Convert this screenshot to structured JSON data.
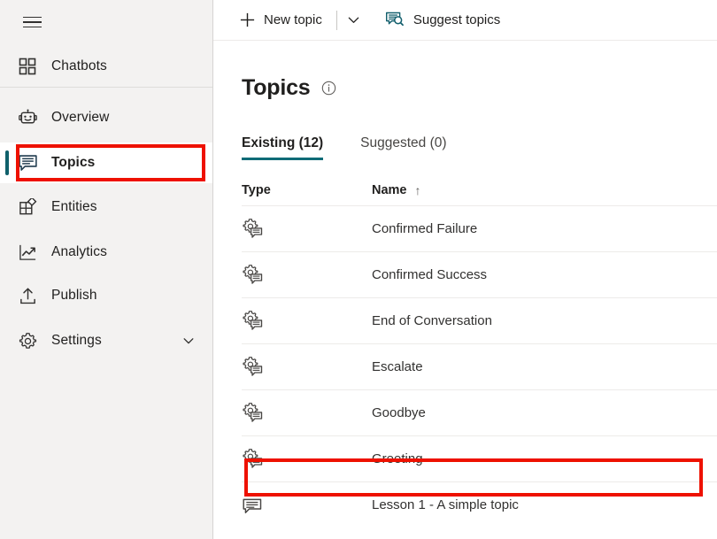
{
  "sidebar": {
    "menu_icon": "hamburger-icon",
    "items": [
      {
        "label": "Chatbots",
        "icon": "grid-apps-icon",
        "selected": false,
        "chevron": false
      },
      {
        "label": "Overview",
        "icon": "robot-icon",
        "selected": false,
        "chevron": false
      },
      {
        "label": "Topics",
        "icon": "chat-bubble-icon",
        "selected": true,
        "chevron": false
      },
      {
        "label": "Entities",
        "icon": "entities-icon",
        "selected": false,
        "chevron": false
      },
      {
        "label": "Analytics",
        "icon": "line-chart-icon",
        "selected": false,
        "chevron": false
      },
      {
        "label": "Publish",
        "icon": "upload-icon",
        "selected": false,
        "chevron": false
      },
      {
        "label": "Settings",
        "icon": "gear-icon",
        "selected": false,
        "chevron": true
      }
    ]
  },
  "toolbar": {
    "new_topic_label": "New topic",
    "new_topic_icon": "plus-icon",
    "new_topic_caret_icon": "chevron-down-icon",
    "suggest_topics_label": "Suggest topics",
    "suggest_topics_icon": "suggest-topics-icon"
  },
  "page": {
    "title": "Topics",
    "info_icon": "info-circle-icon"
  },
  "tabs": [
    {
      "label": "Existing (12)",
      "active": true
    },
    {
      "label": "Suggested (0)",
      "active": false
    }
  ],
  "table": {
    "columns": [
      {
        "key": "type",
        "label": "Type"
      },
      {
        "key": "name",
        "label": "Name",
        "sort": "ascending",
        "sort_icon": "↑"
      }
    ],
    "rows": [
      {
        "type_icon": "system-topic-icon",
        "name": "Confirmed Failure",
        "highlighted": false
      },
      {
        "type_icon": "system-topic-icon",
        "name": "Confirmed Success",
        "highlighted": false
      },
      {
        "type_icon": "system-topic-icon",
        "name": "End of Conversation",
        "highlighted": false
      },
      {
        "type_icon": "system-topic-icon",
        "name": "Escalate",
        "highlighted": false
      },
      {
        "type_icon": "system-topic-icon",
        "name": "Goodbye",
        "highlighted": false
      },
      {
        "type_icon": "system-topic-icon",
        "name": "Greeting",
        "highlighted": true
      },
      {
        "type_icon": "custom-topic-icon",
        "name": "Lesson 1 - A simple topic",
        "highlighted": false
      }
    ]
  },
  "annotations": [
    {
      "name": "sidebar-topics-highlight",
      "color": "#ee1100"
    },
    {
      "name": "greeting-row-highlight",
      "color": "#ee1100"
    }
  ],
  "colors": {
    "accent": "#0f6b77",
    "sidebar_bg": "#f3f2f1",
    "annotation": "#ee1100",
    "text": "#201f1e"
  }
}
